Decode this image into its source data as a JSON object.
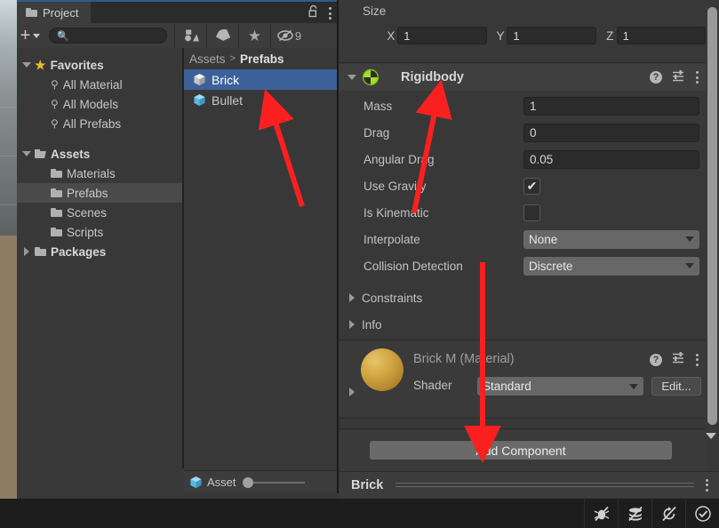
{
  "scene_sliver": {
    "sky_color": "#a8b2b4",
    "ground_color": "#8e7c65"
  },
  "project_panel": {
    "tab_label": "Project",
    "tab_icon": "folder-icon",
    "lock_icon": "lock-open-icon",
    "menu_icon": "kebab-menu-icon",
    "toolbar": {
      "create_label": "+",
      "create_dropdown_icon": "chevron-down-icon",
      "search_placeholder": "",
      "search_value": "",
      "search_icon": "search-icon",
      "buttons": [
        {
          "name": "filter-by-type-icon",
          "label": ""
        },
        {
          "name": "filter-by-label-icon",
          "label": ""
        },
        {
          "name": "favorites-star-icon",
          "label": ""
        }
      ],
      "hidden_toggle": {
        "icon": "hidden-eye-icon",
        "count": "9"
      }
    },
    "tree": [
      {
        "label": "Favorites",
        "indent": 0,
        "twisty": "down",
        "icon": "star-icon",
        "bold": true,
        "selected": false
      },
      {
        "label": "All Material",
        "indent": 1,
        "twisty": "",
        "icon": "search-icon",
        "bold": false,
        "selected": false
      },
      {
        "label": "All Models",
        "indent": 1,
        "twisty": "",
        "icon": "search-icon",
        "bold": false,
        "selected": false
      },
      {
        "label": "All Prefabs",
        "indent": 1,
        "twisty": "",
        "icon": "search-icon",
        "bold": false,
        "selected": false
      },
      {
        "label": "",
        "indent": 0,
        "twisty": "",
        "icon": "",
        "bold": false,
        "selected": false
      },
      {
        "label": "Assets",
        "indent": 0,
        "twisty": "down",
        "icon": "folder-open-icon",
        "bold": true,
        "selected": false
      },
      {
        "label": "Materials",
        "indent": 1,
        "twisty": "",
        "icon": "folder-icon",
        "bold": false,
        "selected": false
      },
      {
        "label": "Prefabs",
        "indent": 1,
        "twisty": "",
        "icon": "folder-icon",
        "bold": false,
        "selected": true
      },
      {
        "label": "Scenes",
        "indent": 1,
        "twisty": "",
        "icon": "folder-icon",
        "bold": false,
        "selected": false
      },
      {
        "label": "Scripts",
        "indent": 1,
        "twisty": "",
        "icon": "folder-icon",
        "bold": false,
        "selected": false
      },
      {
        "label": "Packages",
        "indent": 0,
        "twisty": "right",
        "icon": "folder-icon",
        "bold": true,
        "selected": false
      }
    ],
    "breadcrumb": {
      "root": "Assets",
      "separator": ">",
      "current": "Prefabs"
    },
    "assets": [
      {
        "label": "Brick",
        "icon": "prefab-cube-icon",
        "selected": true,
        "color": "#d8d8d8"
      },
      {
        "label": "Bullet",
        "icon": "prefab-cube-icon",
        "selected": false,
        "color": "#6cc0e8"
      }
    ],
    "status": {
      "label": "Asset",
      "icon": "prefab-cube-icon",
      "zoom_slider": "0"
    }
  },
  "inspector": {
    "size": {
      "label": "Size",
      "axes": [
        {
          "axis": "X",
          "value": "1"
        },
        {
          "axis": "Y",
          "value": "1"
        },
        {
          "axis": "Z",
          "value": "1"
        }
      ]
    },
    "rigidbody": {
      "title": "Rigidbody",
      "icon": "rigidbody-icon",
      "twisty": "down",
      "help_icon": "help-icon",
      "preset_icon": "preset-icon",
      "menu_icon": "kebab-menu-icon",
      "properties": [
        {
          "label": "Mass",
          "type": "text",
          "value": "1"
        },
        {
          "label": "Drag",
          "type": "text",
          "value": "0"
        },
        {
          "label": "Angular Drag",
          "type": "text",
          "value": "0.05"
        },
        {
          "label": "Use Gravity",
          "type": "checkbox",
          "value": "checked"
        },
        {
          "label": "Is Kinematic",
          "type": "checkbox",
          "value": "unchecked"
        },
        {
          "label": "Interpolate",
          "type": "dropdown",
          "value": "None"
        },
        {
          "label": "Collision Detection",
          "type": "dropdown",
          "value": "Discrete"
        }
      ],
      "foldouts": [
        {
          "label": "Constraints",
          "twisty": "right"
        },
        {
          "label": "Info",
          "twisty": "right"
        }
      ]
    },
    "material": {
      "title": "Brick M (Material)",
      "preview_icon": "material-sphere-preview",
      "preview_color": "#d4a945",
      "twisty": "right",
      "shader_label": "Shader",
      "shader_value": "Standard",
      "edit_label": "Edit...",
      "help_icon": "help-icon",
      "preset_icon": "preset-icon",
      "menu_icon": "kebab-menu-icon"
    },
    "add_component_label": "Add Component",
    "name_bar": {
      "name": "Brick",
      "menu_icon": "kebab-menu-icon"
    }
  },
  "statusbar": {
    "buttons": [
      {
        "name": "debug-disabled-icon",
        "label": ""
      },
      {
        "name": "layers-disabled-icon",
        "label": ""
      },
      {
        "name": "sync-disabled-icon",
        "label": ""
      },
      {
        "name": "check-circle-icon",
        "label": ""
      }
    ]
  },
  "annotations": {
    "arrow_color": "#fb2020",
    "arrows": [
      {
        "name": "arrow-to-brick-asset",
        "target": "Brick"
      },
      {
        "name": "arrow-to-rigidbody-mass",
        "target": "Mass"
      },
      {
        "name": "arrow-to-add-component",
        "target": "Add Component"
      }
    ]
  }
}
